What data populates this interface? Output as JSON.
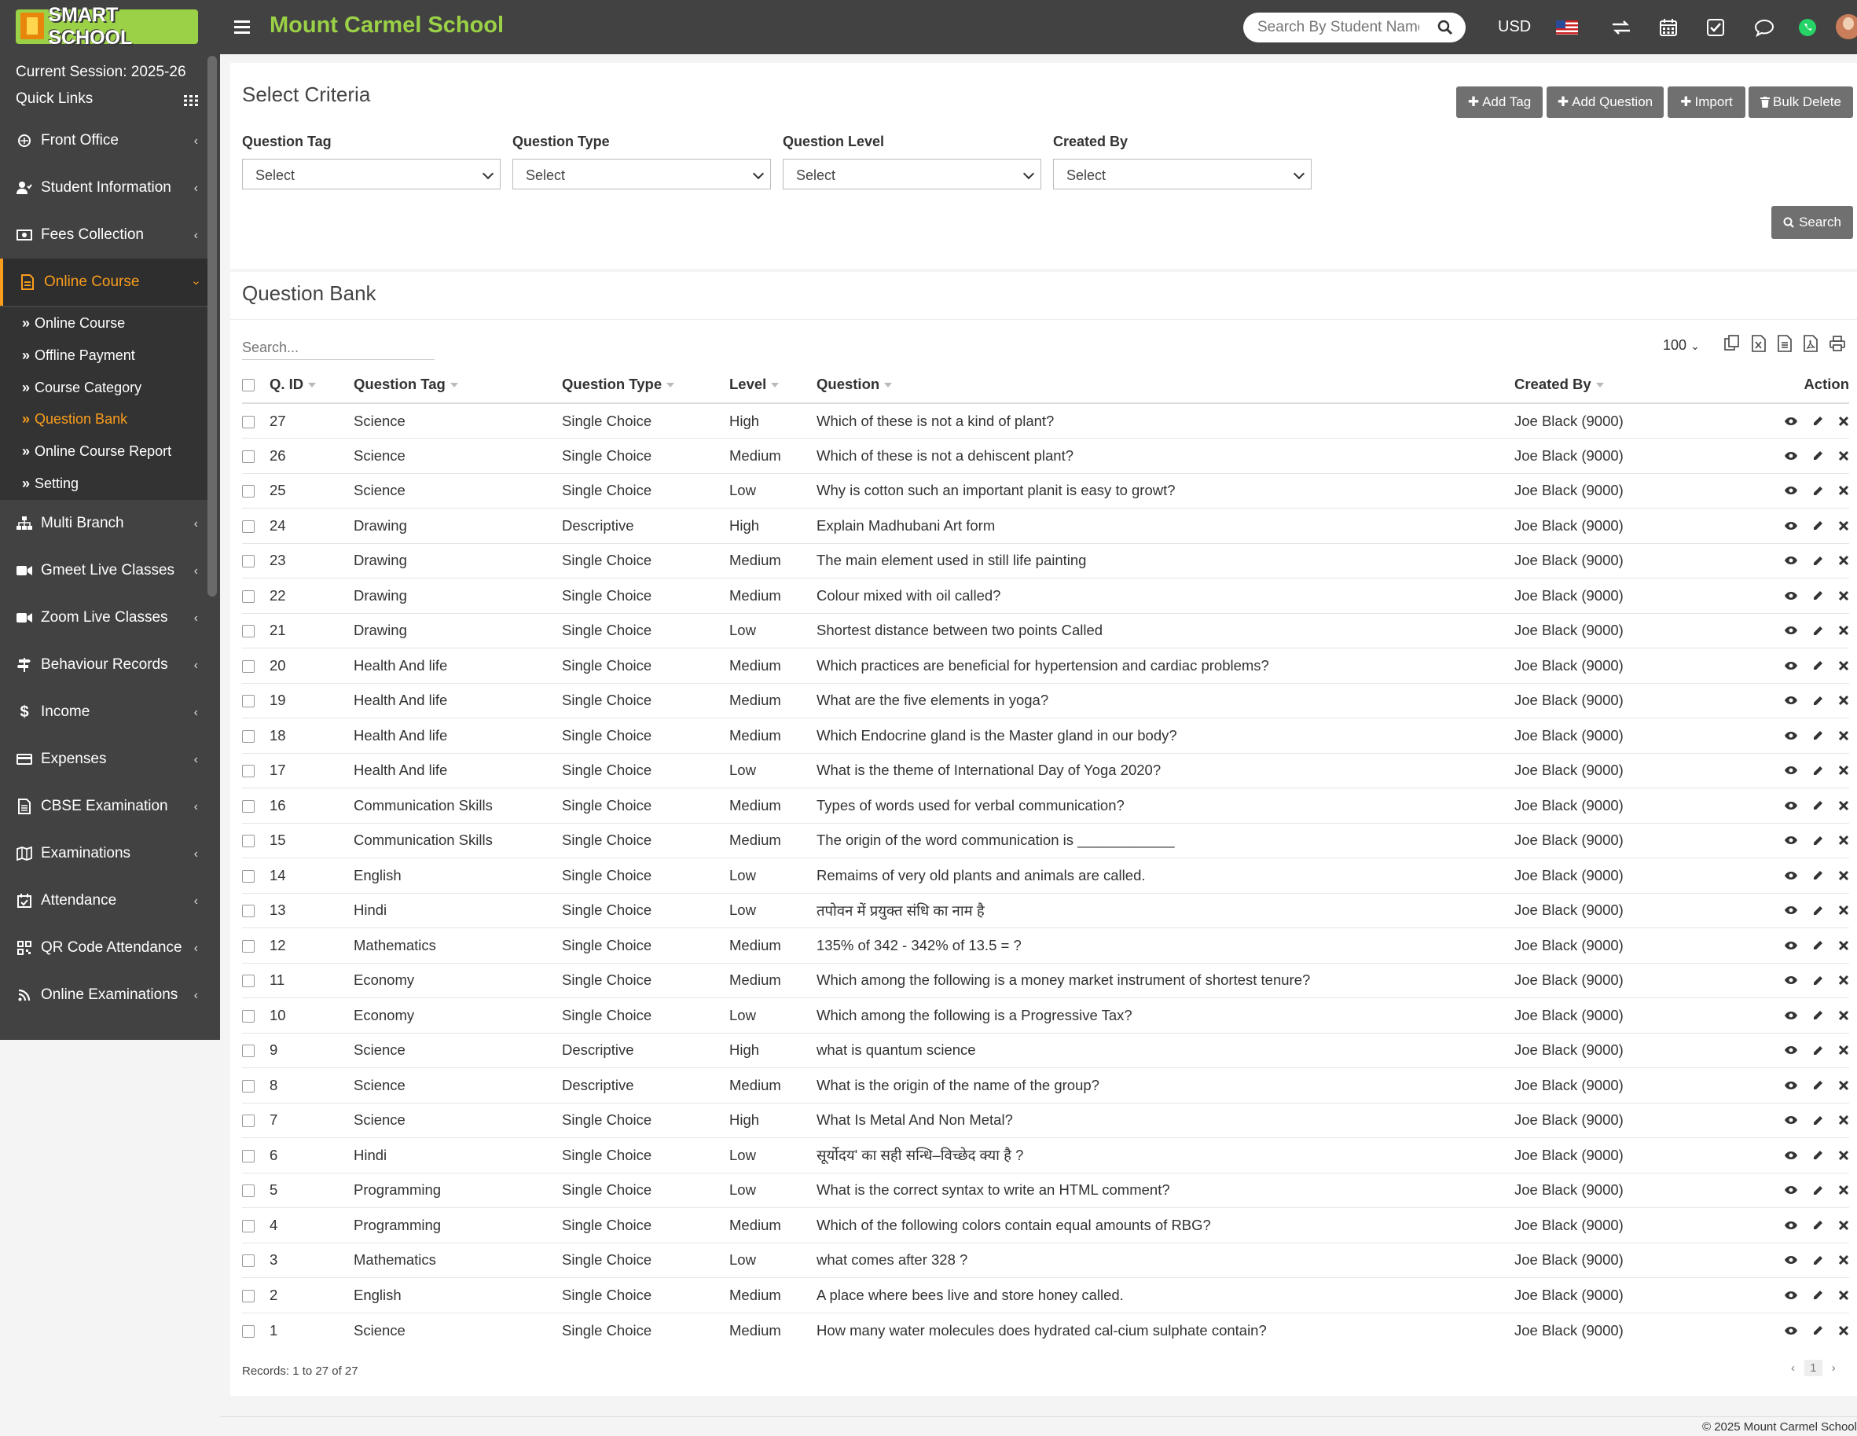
{
  "brand": {
    "logo_text": "SMART SCHOOL",
    "school_name": "Mount Carmel School"
  },
  "header": {
    "search_placeholder": "Search By Student Name",
    "currency": "USD"
  },
  "sidebar": {
    "session": "Current Session: 2025-26",
    "quick_links": "Quick Links",
    "items": [
      {
        "label": "Front Office",
        "icon": "front-office-icon"
      },
      {
        "label": "Student Information",
        "icon": "student-icon"
      },
      {
        "label": "Fees Collection",
        "icon": "money-icon"
      },
      {
        "label": "Online Course",
        "icon": "course-icon"
      },
      {
        "label": "Multi Branch",
        "icon": "branch-icon"
      },
      {
        "label": "Gmeet Live Classes",
        "icon": "video-icon"
      },
      {
        "label": "Zoom Live Classes",
        "icon": "video-icon"
      },
      {
        "label": "Behaviour Records",
        "icon": "signpost-icon"
      },
      {
        "label": "Income",
        "icon": "dollar-icon"
      },
      {
        "label": "Expenses",
        "icon": "card-icon"
      },
      {
        "label": "CBSE Examination",
        "icon": "document-icon"
      },
      {
        "label": "Examinations",
        "icon": "map-icon"
      },
      {
        "label": "Attendance",
        "icon": "calendar-check-icon"
      },
      {
        "label": "QR Code Attendance",
        "icon": "qrcode-icon"
      },
      {
        "label": "Online Examinations",
        "icon": "rss-icon"
      }
    ],
    "submenu": [
      "Online Course",
      "Offline Payment",
      "Course Category",
      "Question Bank",
      "Online Course Report",
      "Setting"
    ]
  },
  "criteria": {
    "title": "Select Criteria",
    "buttons": {
      "add_tag": "Add Tag",
      "add_question": "Add Question",
      "import": "Import",
      "bulk_delete": "Bulk Delete"
    },
    "filters": [
      {
        "label": "Question Tag",
        "value": "Select"
      },
      {
        "label": "Question Type",
        "value": "Select"
      },
      {
        "label": "Question Level",
        "value": "Select"
      },
      {
        "label": "Created By",
        "value": "Select"
      }
    ],
    "search_button": "Search"
  },
  "bank": {
    "title": "Question Bank",
    "search_placeholder": "Search...",
    "page_length": "100",
    "columns": {
      "id": "Q. ID",
      "tag": "Question Tag",
      "type": "Question Type",
      "level": "Level",
      "question": "Question",
      "created_by": "Created By",
      "action": "Action"
    },
    "rows": [
      [
        "27",
        "Science",
        "Single Choice",
        "High",
        "Which of these is not a kind of plant?",
        "Joe Black (9000)"
      ],
      [
        "26",
        "Science",
        "Single Choice",
        "Medium",
        "Which of these is not a dehiscent plant?",
        "Joe Black (9000)"
      ],
      [
        "25",
        "Science",
        "Single Choice",
        "Low",
        "Why is cotton such an important planit is easy to growt?",
        "Joe Black (9000)"
      ],
      [
        "24",
        "Drawing",
        "Descriptive",
        "High",
        "Explain Madhubani Art form",
        "Joe Black (9000)"
      ],
      [
        "23",
        "Drawing",
        "Single Choice",
        "Medium",
        "The main element used in still life painting",
        "Joe Black (9000)"
      ],
      [
        "22",
        "Drawing",
        "Single Choice",
        "Medium",
        "Colour mixed with oil called?",
        "Joe Black (9000)"
      ],
      [
        "21",
        "Drawing",
        "Single Choice",
        "Low",
        "Shortest distance between two points Called",
        "Joe Black (9000)"
      ],
      [
        "20",
        "Health And life",
        "Single Choice",
        "Medium",
        "Which practices are beneficial for hypertension and cardiac problems?",
        "Joe Black (9000)"
      ],
      [
        "19",
        "Health And life",
        "Single Choice",
        "Medium",
        "What are the five elements in yoga?",
        "Joe Black (9000)"
      ],
      [
        "18",
        "Health And life",
        "Single Choice",
        "Medium",
        "Which Endocrine gland is the Master gland in our body?",
        "Joe Black (9000)"
      ],
      [
        "17",
        "Health And life",
        "Single Choice",
        "Low",
        "What is the theme of International Day of Yoga 2020?",
        "Joe Black (9000)"
      ],
      [
        "16",
        "Communication Skills",
        "Single Choice",
        "Medium",
        "Types of words used for verbal communication?",
        "Joe Black (9000)"
      ],
      [
        "15",
        "Communication Skills",
        "Single Choice",
        "Medium",
        "The origin of the word communication is ____________",
        "Joe Black (9000)"
      ],
      [
        "14",
        "English",
        "Single Choice",
        "Low",
        "Remaims of very old plants and animals are called.",
        "Joe Black (9000)"
      ],
      [
        "13",
        "Hindi",
        "Single Choice",
        "Low",
        "तपोवन में प्रयुक्त संधि का नाम है",
        "Joe Black (9000)"
      ],
      [
        "12",
        "Mathematics",
        "Single Choice",
        "Medium",
        "135% of 342 - 342% of 13.5 = ?",
        "Joe Black (9000)"
      ],
      [
        "11",
        "Economy",
        "Single Choice",
        "Medium",
        "Which among the following is a money market instrument of shortest tenure?",
        "Joe Black (9000)"
      ],
      [
        "10",
        "Economy",
        "Single Choice",
        "Low",
        "Which among the following is a Progressive Tax?",
        "Joe Black (9000)"
      ],
      [
        "9",
        "Science",
        "Descriptive",
        "High",
        "what is quantum science",
        "Joe Black (9000)"
      ],
      [
        "8",
        "Science",
        "Descriptive",
        "Medium",
        "What is the origin of the name of the group?",
        "Joe Black (9000)"
      ],
      [
        "7",
        "Science",
        "Single Choice",
        "High",
        "What Is Metal And Non Metal?",
        "Joe Black (9000)"
      ],
      [
        "6",
        "Hindi",
        "Single Choice",
        "Low",
        "सूर्योदय' का सही सन्धि–विच्छेद क्या है ?",
        "Joe Black (9000)"
      ],
      [
        "5",
        "Programming",
        "Single Choice",
        "Low",
        "What is the correct syntax to write an HTML comment?",
        "Joe Black (9000)"
      ],
      [
        "4",
        "Programming",
        "Single Choice",
        "Medium",
        "Which of the following colors contain equal amounts of RBG?",
        "Joe Black (9000)"
      ],
      [
        "3",
        "Mathematics",
        "Single Choice",
        "Low",
        "what comes after 328 ?",
        "Joe Black (9000)"
      ],
      [
        "2",
        "English",
        "Single Choice",
        "Medium",
        "A place where bees live and store honey called.",
        "Joe Black (9000)"
      ],
      [
        "1",
        "Science",
        "Single Choice",
        "Medium",
        "How many water molecules does hydrated cal-cium sulphate contain?",
        "Joe Black (9000)"
      ]
    ],
    "records_text": "Records: 1 to 27 of 27",
    "current_page": "1"
  },
  "footer": {
    "text": "© 2025 Mount Carmel School"
  },
  "colors": {
    "sidebar_bg": "#424242",
    "accent": "#f99d1c",
    "brand_green": "#9ad146",
    "button_gray": "#707070"
  }
}
